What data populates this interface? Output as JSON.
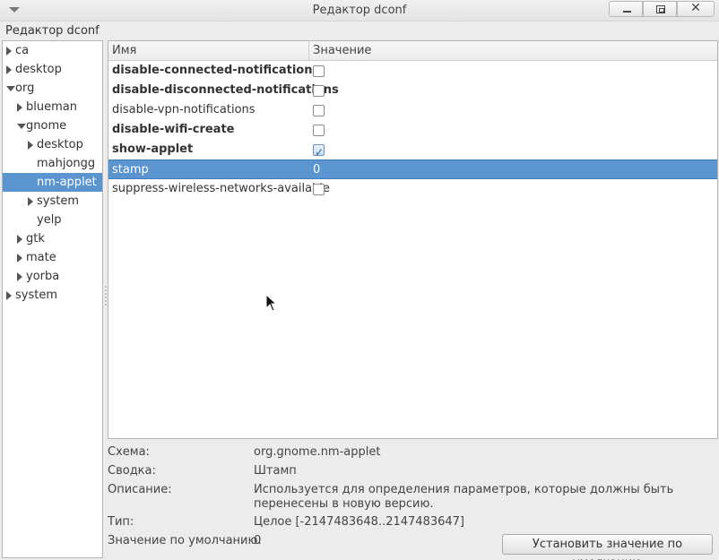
{
  "window": {
    "title": "Редактор dconf",
    "app_label": "Редактор dconf"
  },
  "tree": {
    "items": [
      {
        "label": "ca",
        "expander": "collapsed",
        "level": 0,
        "selected": false
      },
      {
        "label": "desktop",
        "expander": "collapsed",
        "level": 0,
        "selected": false
      },
      {
        "label": "org",
        "expander": "expanded",
        "level": 0,
        "selected": false
      },
      {
        "label": "blueman",
        "expander": "collapsed",
        "level": 1,
        "selected": false
      },
      {
        "label": "gnome",
        "expander": "expanded",
        "level": 1,
        "selected": false
      },
      {
        "label": "desktop",
        "expander": "collapsed",
        "level": 2,
        "selected": false
      },
      {
        "label": "mahjongg",
        "expander": "none",
        "level": 2,
        "selected": false
      },
      {
        "label": "nm-applet",
        "expander": "none",
        "level": 2,
        "selected": true
      },
      {
        "label": "system",
        "expander": "collapsed",
        "level": 2,
        "selected": false
      },
      {
        "label": "yelp",
        "expander": "none",
        "level": 2,
        "selected": false
      },
      {
        "label": "gtk",
        "expander": "collapsed",
        "level": 1,
        "selected": false
      },
      {
        "label": "mate",
        "expander": "collapsed",
        "level": 1,
        "selected": false
      },
      {
        "label": "yorba",
        "expander": "collapsed",
        "level": 1,
        "selected": false
      },
      {
        "label": "system",
        "expander": "collapsed",
        "level": 0,
        "selected": false
      }
    ]
  },
  "table": {
    "headers": {
      "name": "Имя",
      "value": "Значение"
    },
    "rows": [
      {
        "name": "disable-connected-notifications",
        "bold": true,
        "type": "bool",
        "checked": false,
        "selected": false
      },
      {
        "name": "disable-disconnected-notifications",
        "bold": true,
        "type": "bool",
        "checked": false,
        "selected": false
      },
      {
        "name": "disable-vpn-notifications",
        "bold": false,
        "type": "bool",
        "checked": false,
        "selected": false
      },
      {
        "name": "disable-wifi-create",
        "bold": true,
        "type": "bool",
        "checked": false,
        "selected": false
      },
      {
        "name": "show-applet",
        "bold": true,
        "type": "bool",
        "checked": true,
        "selected": false
      },
      {
        "name": "stamp",
        "bold": false,
        "type": "text",
        "value": "0",
        "selected": true
      },
      {
        "name": "suppress-wireless-networks-available",
        "bold": false,
        "type": "bool",
        "checked": false,
        "selected": false
      }
    ]
  },
  "details": {
    "schema_label": "Схема:",
    "schema_value": "org.gnome.nm-applet",
    "summary_label": "Сводка:",
    "summary_value": "Штамп",
    "description_label": "Описание:",
    "description_value": "Используется для определения параметров, которые должны быть перенесены в новую версию.",
    "type_label": "Тип:",
    "type_value": "Целое [-2147483648..2147483647]",
    "default_label": "Значение по умолчанию:",
    "default_value": "0",
    "set_default_button": "Установить значение по умолчанию"
  },
  "colors": {
    "selection": "#5a95d0",
    "background": "#ececec"
  }
}
